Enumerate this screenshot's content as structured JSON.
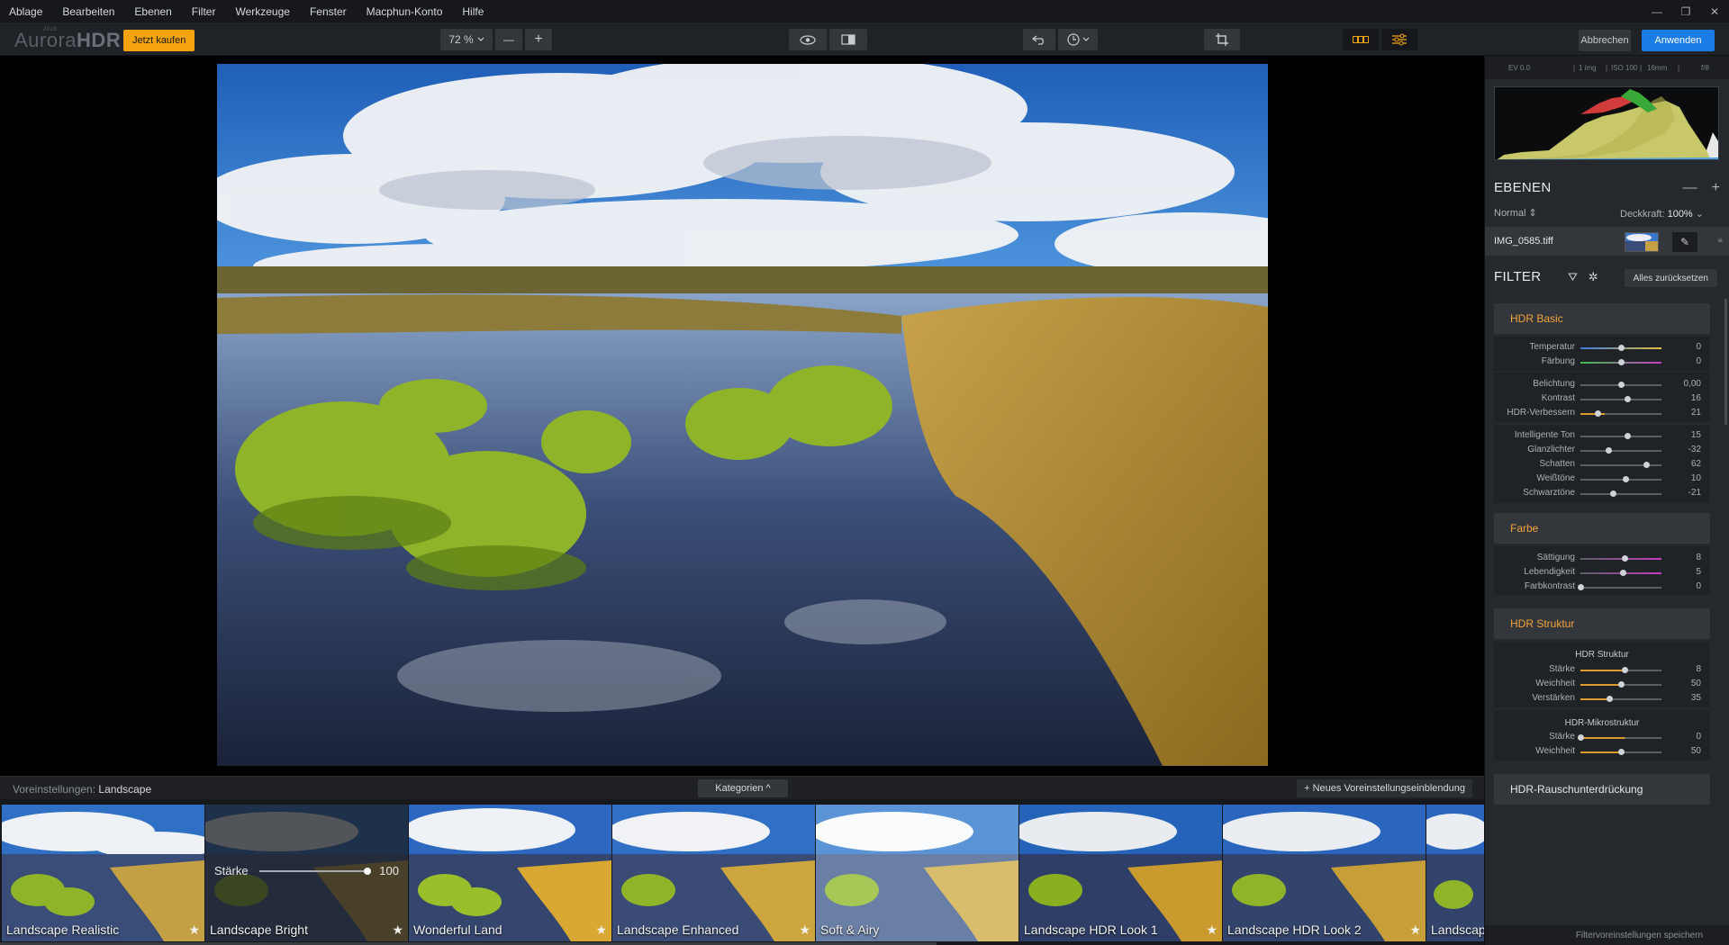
{
  "menu": [
    "Ablage",
    "Bearbeiten",
    "Ebenen",
    "Filter",
    "Werkzeuge",
    "Fenster",
    "Macphun-Konto",
    "Hilfe"
  ],
  "app": {
    "logo_light": "Aurora",
    "logo_bold": "HDR",
    "logo_year": "2018"
  },
  "toolbar": {
    "buy_label": "Jetzt kaufen",
    "zoom": "72 %",
    "zoom_out": "—",
    "zoom_in": "+",
    "cancel_label": "Abbrechen",
    "apply_label": "Anwenden"
  },
  "exif": {
    "ev": "EV 0.0",
    "img": "1 img",
    "iso": "ISO 100",
    "focal": "16mm",
    "aperture": "f/8"
  },
  "layers": {
    "title": "EBENEN",
    "blend_mode": "Normal",
    "opacity_label": "Deckkraft:",
    "opacity_value": "100%",
    "layer_name": "IMG_0585.tiff"
  },
  "filter": {
    "title": "FILTER",
    "reset_label": "Alles zurücksetzen",
    "hdr_basic": {
      "title": "HDR Basic",
      "group1": [
        {
          "label": "Temperatur",
          "value": "0",
          "pos": 0.5
        },
        {
          "label": "Färbung",
          "value": "0",
          "pos": 0.5
        }
      ],
      "group2": [
        {
          "label": "Belichtung",
          "value": "0,00",
          "pos": 0.5
        },
        {
          "label": "Kontrast",
          "value": "16",
          "pos": 0.58
        },
        {
          "label": "HDR-Verbessern",
          "value": "21",
          "pos": 0.21
        }
      ],
      "group3": [
        {
          "label": "Intelligente Ton",
          "value": "15",
          "pos": 0.575
        },
        {
          "label": "Glanzlichter",
          "value": "-32",
          "pos": 0.34
        },
        {
          "label": "Schatten",
          "value": "62",
          "pos": 0.81
        },
        {
          "label": "Weißtöne",
          "value": "10",
          "pos": 0.55
        },
        {
          "label": "Schwarztöne",
          "value": "-21",
          "pos": 0.395
        }
      ]
    },
    "farbe": {
      "title": "Farbe",
      "rows": [
        {
          "label": "Sättigung",
          "value": "8",
          "pos": 0.54
        },
        {
          "label": "Lebendigkeit",
          "value": "5",
          "pos": 0.525
        },
        {
          "label": "Farbkontrast",
          "value": "0",
          "pos": 0.0
        }
      ]
    },
    "hdr_struktur": {
      "title": "HDR Struktur",
      "sub1": "HDR Struktur",
      "rows1": [
        {
          "label": "Stärke",
          "value": "8",
          "pos": 0.54
        },
        {
          "label": "Weichheit",
          "value": "50",
          "pos": 0.5
        },
        {
          "label": "Verstärken",
          "value": "35",
          "pos": 0.35
        }
      ],
      "sub2": "HDR-Mikrostruktur",
      "rows2": [
        {
          "label": "Stärke",
          "value": "0",
          "pos": 0.0
        },
        {
          "label": "Weichheit",
          "value": "50",
          "pos": 0.5
        }
      ]
    },
    "noise_title": "HDR-Rauschunterdrückung",
    "save_label": "Filtervoreinstellungen speichern"
  },
  "presets": {
    "prefix": "Voreinstellungen:",
    "category": "Landscape",
    "categories_label": "Kategorien ^",
    "new_overlay": "+ Neues Voreinstellungseinblendung",
    "strength_label": "Stärke",
    "strength_value": "100",
    "strength_level": 1.0,
    "items": [
      "Landscape Realistic",
      "Landscape Bright",
      "Wonderful Land",
      "Landscape Enhanced",
      "Soft & Airy",
      "Landscape HDR Look 1",
      "Landscape HDR Look 2",
      "Landscape"
    ]
  },
  "colors": {
    "accent": "#f4a20d",
    "apply": "#1a7de6",
    "section_title": "#f3a33a"
  }
}
